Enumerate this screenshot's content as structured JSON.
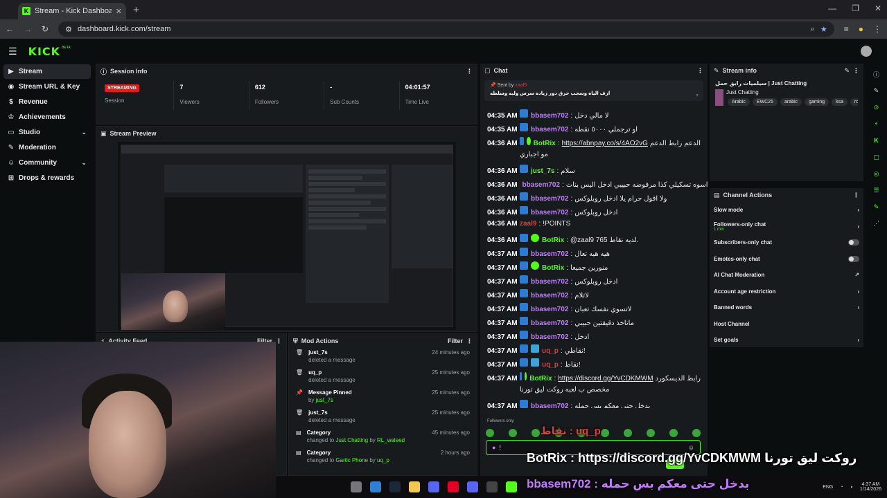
{
  "browser": {
    "tab_title": "Stream - Kick Dashboard",
    "url": "dashboard.kick.com/stream",
    "tab_favicon": "K"
  },
  "brand": {
    "logo": "KICK",
    "beta": "BETA"
  },
  "sidebar": {
    "items": [
      {
        "label": "Stream",
        "icon": "play-icon",
        "active": true
      },
      {
        "label": "Stream URL & Key",
        "icon": "globe-icon"
      },
      {
        "label": "Revenue",
        "icon": "dollar-icon"
      },
      {
        "label": "Achievements",
        "icon": "trophy-icon"
      },
      {
        "label": "Studio",
        "icon": "monitor-icon",
        "expand": true
      },
      {
        "label": "Moderation",
        "icon": "wrench-icon"
      },
      {
        "label": "Community",
        "icon": "people-icon",
        "expand": true
      },
      {
        "label": "Drops & rewards",
        "icon": "gift-icon"
      }
    ]
  },
  "session": {
    "title": "Session Info",
    "status": "STREAMING",
    "session_label": "Session",
    "stats": [
      {
        "v": "7",
        "l": "Viewers"
      },
      {
        "v": "612",
        "l": "Followers"
      },
      {
        "v": "-",
        "l": "Sub Counts"
      },
      {
        "v": "04:01:57",
        "l": "Time Live"
      }
    ]
  },
  "preview": {
    "title": "Stream Preview"
  },
  "activity": {
    "title": "Activity Feed",
    "filter": "Filter"
  },
  "mod": {
    "title": "Mod Actions",
    "filter": "Filter",
    "items": [
      {
        "t": "just_7s",
        "s": "deleted a message",
        "tm": "24 minutes ago",
        "icon": "trash-icon"
      },
      {
        "t": "uq_p",
        "s": "deleted a message",
        "tm": "25 minutes ago",
        "icon": "trash-icon"
      },
      {
        "t": "Message Pinned",
        "s": "by",
        "s2": "just_7s",
        "tm": "25 minutes ago",
        "icon": "pin-icon"
      },
      {
        "t": "just_7s",
        "s": "deleted a message",
        "tm": "25 minutes ago",
        "icon": "trash-icon"
      },
      {
        "t": "Category",
        "s": "changed to",
        "s2": "Just Chatting",
        "s3": "by",
        "s4": "RL_waleed",
        "tm": "45 minutes ago",
        "icon": "folder-icon"
      },
      {
        "t": "Category",
        "s": "changed to",
        "s2": "Gartic Phone",
        "s3": "by",
        "s4": "uq_p",
        "tm": "2 hours ago",
        "icon": "folder-icon"
      }
    ]
  },
  "chat": {
    "title": "Chat",
    "pinned_sentby": "Sent by",
    "pinned_user": "zaal9",
    "pinned_msg": "ارف الياه وسحب حرق دور زياده سرس وليه وسلطه",
    "messages": [
      {
        "tm": "04:35 AM",
        "u": "bbasem702",
        "c": "#c47bff",
        "b": "k",
        "m": "لا مالي دخل"
      },
      {
        "tm": "04:35 AM",
        "u": "bbasem702",
        "c": "#c47bff",
        "b": "k",
        "m": "او ترجملي ٥٠٠٠ نقطه"
      },
      {
        "tm": "04:36 AM",
        "u": "BotRix",
        "c": "#53fc18",
        "b": "kv",
        "m": "رابط الدعم",
        "link": "https://abnpay.co/s/4AO2vG",
        "m2": "الدعم"
      },
      {
        "tm": "",
        "u": "",
        "c": "#fff",
        "b": "",
        "m": "مو اجباري"
      },
      {
        "tm": "04:36 AM",
        "u": "just_7s",
        "c": "#53fc18",
        "b": "k",
        "m": "سلام"
      },
      {
        "tm": "04:36 AM",
        "u": "bbasem702",
        "c": "#c47bff",
        "b": "k",
        "m": "اسوه تسكيلي كذا مرفوضه حبيبي ادخل اليس بنات"
      },
      {
        "tm": "04:36 AM",
        "u": "bbasem702",
        "c": "#c47bff",
        "b": "k",
        "m": "ولا اقول حرام يلا ادخل روبلوكس"
      },
      {
        "tm": "04:36 AM",
        "u": "bbasem702",
        "c": "#c47bff",
        "b": "k",
        "m": "ادخل روبلوكس"
      },
      {
        "tm": "04:36 AM",
        "u": "zaal9",
        "c": "#e23b3b",
        "b": "",
        "m": "!POINTS"
      },
      {
        "tm": "04:36 AM",
        "u": "BotRix",
        "c": "#53fc18",
        "b": "kv",
        "m": "@zaal9 765 لديه نقاط."
      },
      {
        "tm": "04:37 AM",
        "u": "bbasem702",
        "c": "#c47bff",
        "b": "k",
        "m": "هيه هيه تعال"
      },
      {
        "tm": "04:37 AM",
        "u": "BotRix",
        "c": "#53fc18",
        "b": "kv",
        "m": "منورين جميعا"
      },
      {
        "tm": "04:37 AM",
        "u": "bbasem702",
        "c": "#c47bff",
        "b": "k",
        "m": "ادخل روبلوكس"
      },
      {
        "tm": "04:37 AM",
        "u": "bbasem702",
        "c": "#c47bff",
        "b": "k",
        "m": "لاتلام"
      },
      {
        "tm": "04:37 AM",
        "u": "bbasem702",
        "c": "#c47bff",
        "b": "k",
        "m": "لاتسوي نفسك تعبان"
      },
      {
        "tm": "04:37 AM",
        "u": "bbasem702",
        "c": "#c47bff",
        "b": "k",
        "m": "ماتاخذ دقيقتين حبيبي"
      },
      {
        "tm": "04:37 AM",
        "u": "bbasem702",
        "c": "#c47bff",
        "b": "k",
        "m": "ادخل"
      },
      {
        "tm": "04:37 AM",
        "u": "uq_p",
        "c": "#e23b3b",
        "b": "kk",
        "m": "نقاطي!"
      },
      {
        "tm": "04:37 AM",
        "u": "uq_p",
        "c": "#e23b3b",
        "b": "kk",
        "m": "نقاط!"
      },
      {
        "tm": "04:37 AM",
        "u": "BotRix",
        "c": "#53fc18",
        "b": "kv",
        "link": "https://discord.gg/YvCDKMWM",
        "m": "رابط الديسكورد"
      },
      {
        "tm": "",
        "u": "",
        "c": "#fff",
        "b": "",
        "m": "مخصص ب لعبه روكت ليق تورنا"
      },
      {
        "tm": "04:37 AM",
        "u": "bbasem702",
        "c": "#c47bff",
        "b": "k",
        "m": "بدخل حتى معكم بس حمله"
      }
    ],
    "followers_only": "Followers only",
    "input_value": "!",
    "send": "Chat"
  },
  "stream_info": {
    "title": "Stream info",
    "stream_title": "سيلميات رايق حمل | Just Chatting",
    "category": "Just Chatting",
    "tags": [
      "Arabic",
      "EWC25",
      "arabic",
      "gaming",
      "ksa",
      "rocke"
    ]
  },
  "channel_actions": {
    "title": "Channel Actions",
    "items": [
      {
        "l": "Slow mode",
        "t": "chev"
      },
      {
        "l": "Followers-only chat",
        "sub": "1 min",
        "t": "chev"
      },
      {
        "l": "Subscribers-only chat",
        "t": "toggle"
      },
      {
        "l": "Emotes-only chat",
        "t": "toggle"
      },
      {
        "l": "AI Chat Moderation",
        "t": "ext"
      },
      {
        "l": "Account age restriction",
        "t": "chev"
      },
      {
        "l": "Banned words",
        "t": "chev"
      },
      {
        "l": "Host Channel",
        "t": ""
      },
      {
        "l": "Set goals",
        "t": "chev"
      }
    ]
  },
  "overlay": {
    "l1": "نقاط : uq_p",
    "l2": "BotRix : https://discord.gg/YvCDKMWM روكت ليق تورنا",
    "l3": "bbasem702 : بدخل حتى معكم بس حمله"
  },
  "taskbar": {
    "lang": "ENG",
    "time": "4:37 AM",
    "date": "1/14/2026"
  }
}
